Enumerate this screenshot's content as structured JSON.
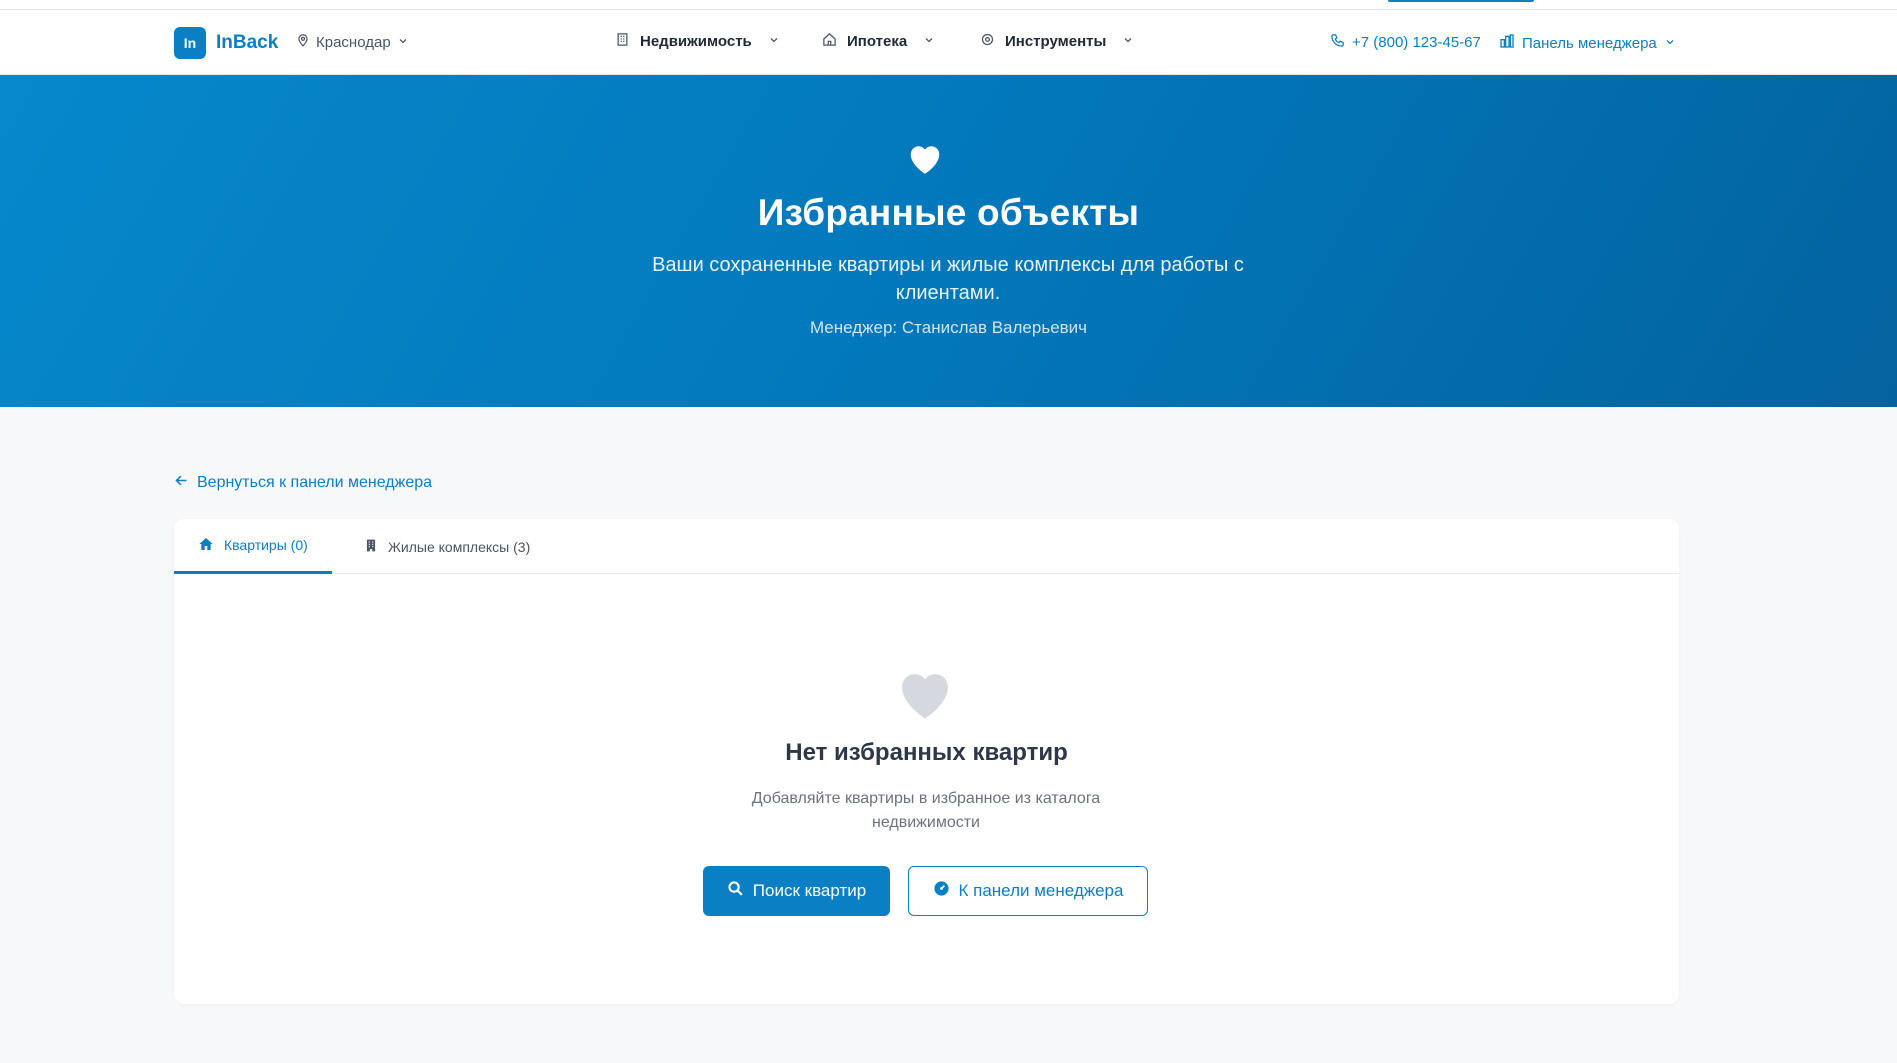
{
  "header": {
    "logo_badge": "In",
    "logo_text": "InBack",
    "city": "Краснодар",
    "nav": [
      {
        "label": "Недвижимость",
        "icon": "building-icon"
      },
      {
        "label": "Ипотека",
        "icon": "home-icon"
      },
      {
        "label": "Инструменты",
        "icon": "gear-icon"
      }
    ],
    "phone": "+7 (800) 123-45-67",
    "manager_panel": "Панель менеджера"
  },
  "hero": {
    "icon": "heart-icon",
    "title": "Избранные объекты",
    "subtitle": "Ваши сохраненные квартиры и жилые комплексы для работы с клиентами.",
    "manager": "Менеджер: Станислав Валерьевич"
  },
  "back_link": "Вернуться к панели менеджера",
  "tabs": [
    {
      "label": "Квартиры (0)",
      "icon": "home-icon",
      "active": true
    },
    {
      "label": "Жилые комплексы (3)",
      "icon": "building-icon",
      "active": false
    }
  ],
  "empty_state": {
    "icon": "heart-icon",
    "title": "Нет избранных квартир",
    "text": "Добавляйте квартиры в избранное из каталога недвижимости",
    "primary_button": "Поиск квартир",
    "secondary_button": "К панели менеджера"
  },
  "colors": {
    "brand": "#0b7fc4",
    "hero_start": "#0788cc",
    "hero_end": "#03639f",
    "empty_icon": "#d5d8de"
  }
}
